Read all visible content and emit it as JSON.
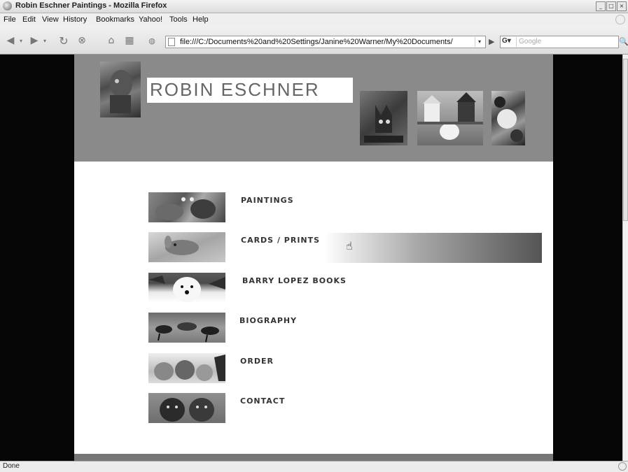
{
  "window": {
    "title": "Robin Eschner Paintings - Mozilla Firefox"
  },
  "menu": [
    "File",
    "Edit",
    "View",
    "History",
    "Bookmarks",
    "Yahoo!",
    "Tools",
    "Help"
  ],
  "toolbar": {
    "url": "file:///C:/Documents%20and%20Settings/Janine%20Warner/My%20Documents/",
    "search_placeholder": "Google",
    "search_engine": "G"
  },
  "site": {
    "logo": "ROBIN ESCHNER",
    "nav": [
      {
        "label": "PAINTINGS"
      },
      {
        "label": "CARDS / PRINTS"
      },
      {
        "label": "BARRY LOPEZ BOOKS"
      },
      {
        "label": "BIOGRAPHY"
      },
      {
        "label": "ORDER"
      },
      {
        "label": "CONTACT"
      }
    ]
  },
  "status": {
    "text": "Done"
  },
  "colors": {
    "header": "#8a8a8a",
    "page_bg": "#050505"
  }
}
